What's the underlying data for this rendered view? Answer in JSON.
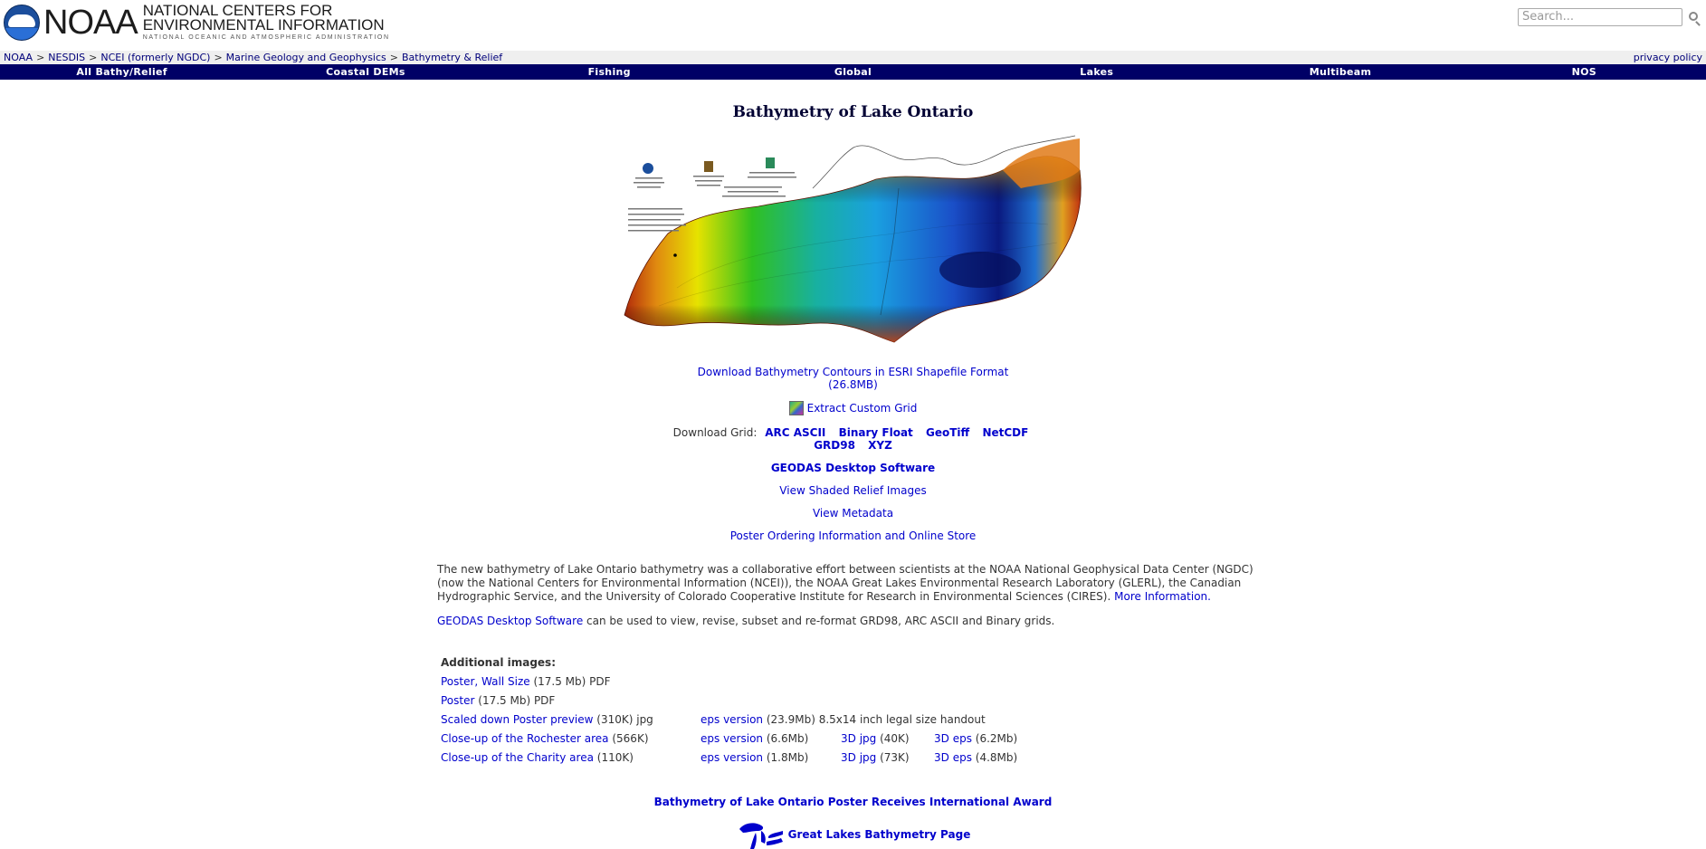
{
  "header": {
    "noaa_word": "NOAA",
    "ncei_line1": "NATIONAL CENTERS FOR",
    "ncei_line2": "ENVIRONMENTAL INFORMATION",
    "ncei_tagline": "NATIONAL OCEANIC AND ATMOSPHERIC ADMINISTRATION",
    "search_placeholder": "Search..."
  },
  "breadcrumb": {
    "items": [
      "NOAA",
      "NESDIS",
      "NCEI (formerly NGDC)",
      "Marine Geology and Geophysics",
      "Bathymetry & Relief"
    ],
    "separator": ">",
    "privacy": "privacy policy"
  },
  "nav": {
    "items": [
      "All Bathy/Relief",
      "Coastal DEMs",
      "Fishing",
      "Global",
      "Lakes",
      "Multibeam",
      "NOS"
    ]
  },
  "main": {
    "title": "Bathymetry of Lake Ontario",
    "download_contours": "Download Bathymetry Contours in ESRI Shapefile Format",
    "download_contours_size": "(26.8MB)",
    "extract_custom_grid": "Extract Custom Grid",
    "download_grid_label": "Download Grid:",
    "grid_formats_row1": [
      "ARC ASCII",
      "Binary Float",
      "GeoTiff",
      "NetCDF"
    ],
    "grid_formats_row2": [
      "GRD98",
      "XYZ"
    ],
    "geodas_software": "GEODAS Desktop Software",
    "view_shaded": "View Shaded Relief Images",
    "view_metadata": "View Metadata",
    "poster_ordering": "Poster Ordering Information and Online Store",
    "description": "The new bathymetry of Lake Ontario bathymetry was a collaborative effort between scientists at the NOAA National Geophysical Data Center (NGDC) (now the National Centers for Environmental Information (NCEI)), the NOAA Great Lakes Environmental Research Laboratory (GLERL), the Canadian Hydrographic Service, and the University of Colorado Cooperative Institute for Research in Environmental Sciences (CIRES).",
    "more_information": "More Information.",
    "geodas_link": "GEODAS Desktop Software",
    "geodas_text": "can be used to view, revise, subset and re-format GRD98, ARC ASCII and Binary grids.",
    "additional_images_heading": "Additional images:",
    "poster_wall": {
      "link": "Poster, Wall Size",
      "info": "(17.5 Mb) PDF"
    },
    "poster": {
      "link": "Poster",
      "info": "(17.5 Mb) PDF"
    },
    "scaled_down": {
      "link": "Scaled down Poster preview",
      "info": "(310K) jpg",
      "eps_link": "eps version",
      "eps_info": "(23.9Mb) 8.5x14 inch legal size handout"
    },
    "rochester": {
      "link": "Close-up of the Rochester area",
      "info": "(566K)",
      "eps_link": "eps version",
      "eps_info": "(6.6Mb)",
      "jpg3d_link": "3D jpg",
      "jpg3d_info": "(40K)",
      "eps3d_link": "3D eps",
      "eps3d_info": "(6.2Mb)"
    },
    "charity": {
      "link": "Close-up of the Charity area",
      "info": "(110K)",
      "eps_link": "eps version",
      "eps_info": "(1.8Mb)",
      "jpg3d_link": "3D jpg",
      "jpg3d_info": "(73K)",
      "eps3d_link": "3D eps",
      "eps3d_info": "(4.8Mb)"
    },
    "award": "Bathymetry of Lake Ontario Poster Receives International Award",
    "great_lakes": "Great Lakes Bathymetry Page"
  }
}
